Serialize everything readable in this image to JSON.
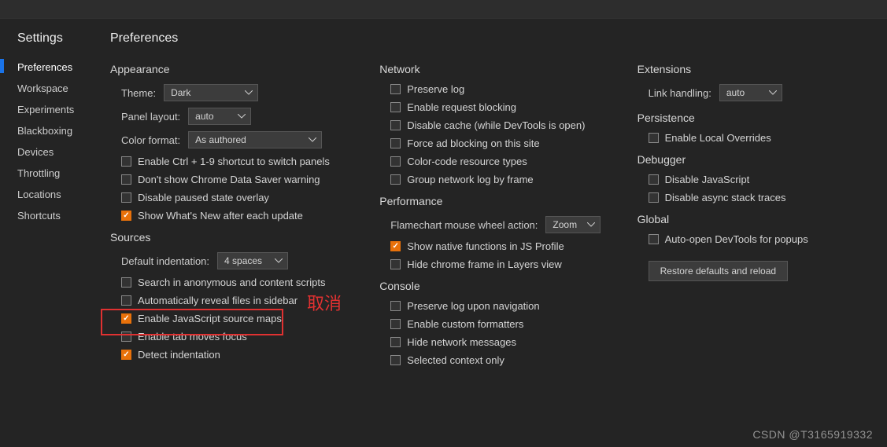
{
  "toolbar": [
    "",
    "",
    "",
    ""
  ],
  "sidebar": {
    "title": "Settings",
    "items": [
      {
        "label": "Preferences",
        "active": true
      },
      {
        "label": "Workspace"
      },
      {
        "label": "Experiments"
      },
      {
        "label": "Blackboxing"
      },
      {
        "label": "Devices"
      },
      {
        "label": "Throttling"
      },
      {
        "label": "Locations"
      },
      {
        "label": "Shortcuts"
      }
    ]
  },
  "page_title": "Preferences",
  "appearance": {
    "title": "Appearance",
    "theme_label": "Theme:",
    "theme_value": "Dark",
    "panel_layout_label": "Panel layout:",
    "panel_layout_value": "auto",
    "color_format_label": "Color format:",
    "color_format_value": "As authored",
    "checks": [
      {
        "label": "Enable Ctrl + 1-9 shortcut to switch panels",
        "checked": false
      },
      {
        "label": "Don't show Chrome Data Saver warning",
        "checked": false
      },
      {
        "label": "Disable paused state overlay",
        "checked": false
      },
      {
        "label": "Show What's New after each update",
        "checked": true
      }
    ]
  },
  "sources": {
    "title": "Sources",
    "default_indent_label": "Default indentation:",
    "default_indent_value": "4 spaces",
    "checks": [
      {
        "label": "Search in anonymous and content scripts",
        "checked": false
      },
      {
        "label": "Automatically reveal files in sidebar",
        "checked": false
      },
      {
        "label": "Enable JavaScript source maps",
        "checked": true,
        "highlighted": true
      },
      {
        "label": "Enable tab moves focus",
        "checked": false
      },
      {
        "label": "Detect indentation",
        "checked": true
      }
    ]
  },
  "network": {
    "title": "Network",
    "checks": [
      {
        "label": "Preserve log",
        "checked": false
      },
      {
        "label": "Enable request blocking",
        "checked": false
      },
      {
        "label": "Disable cache (while DevTools is open)",
        "checked": false
      },
      {
        "label": "Force ad blocking on this site",
        "checked": false
      },
      {
        "label": "Color-code resource types",
        "checked": false
      },
      {
        "label": "Group network log by frame",
        "checked": false
      }
    ]
  },
  "performance": {
    "title": "Performance",
    "flame_label": "Flamechart mouse wheel action:",
    "flame_value": "Zoom",
    "checks": [
      {
        "label": "Show native functions in JS Profile",
        "checked": true
      },
      {
        "label": "Hide chrome frame in Layers view",
        "checked": false
      }
    ]
  },
  "console": {
    "title": "Console",
    "checks": [
      {
        "label": "Preserve log upon navigation",
        "checked": false
      },
      {
        "label": "Enable custom formatters",
        "checked": false
      },
      {
        "label": "Hide network messages",
        "checked": false
      },
      {
        "label": "Selected context only",
        "checked": false
      }
    ]
  },
  "extensions": {
    "title": "Extensions",
    "link_label": "Link handling:",
    "link_value": "auto"
  },
  "persistence": {
    "title": "Persistence",
    "checks": [
      {
        "label": "Enable Local Overrides",
        "checked": false
      }
    ]
  },
  "debugger": {
    "title": "Debugger",
    "checks": [
      {
        "label": "Disable JavaScript",
        "checked": false
      },
      {
        "label": "Disable async stack traces",
        "checked": false
      }
    ]
  },
  "global": {
    "title": "Global",
    "checks": [
      {
        "label": "Auto-open DevTools for popups",
        "checked": false
      }
    ],
    "restore_label": "Restore defaults and reload"
  },
  "annotation": "取消",
  "watermark": "CSDN @T3165919332"
}
